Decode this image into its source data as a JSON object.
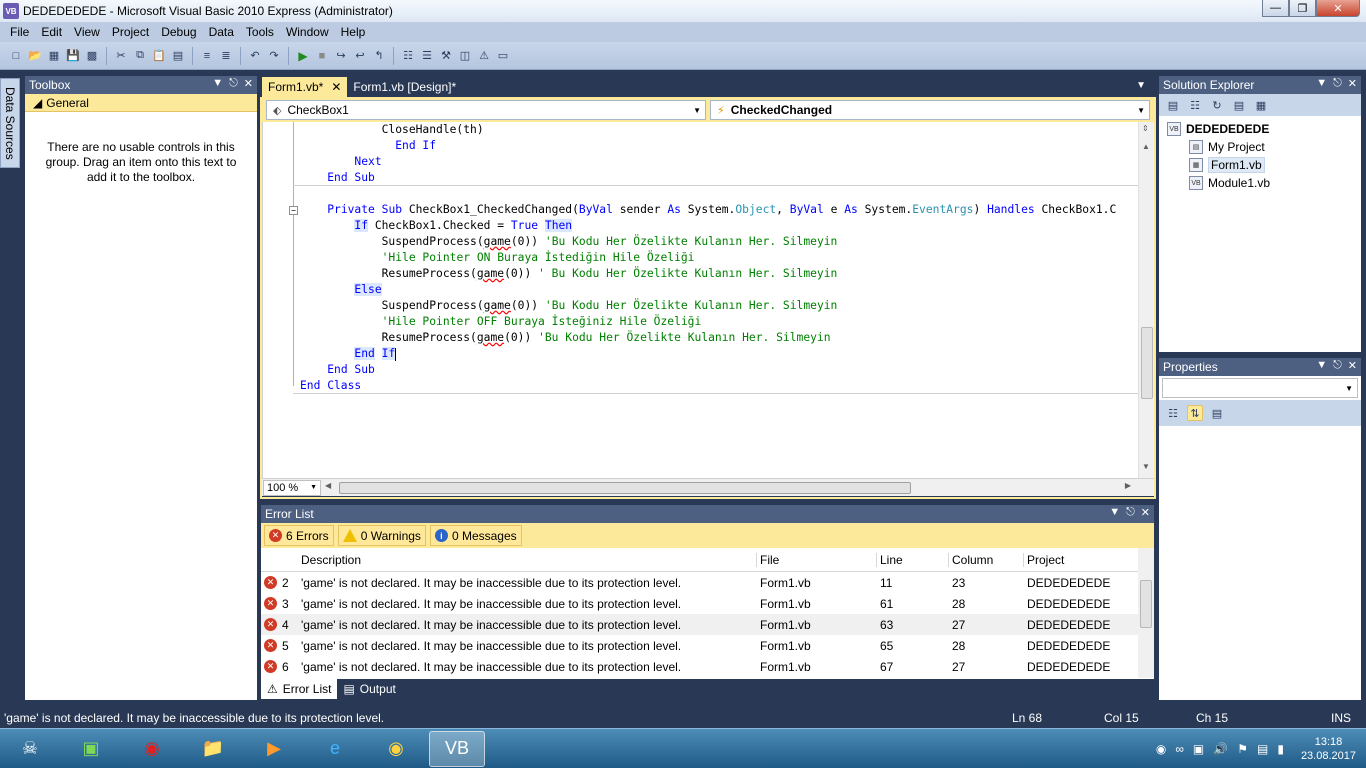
{
  "window": {
    "title": "DEDEDEDEDE - Microsoft Visual Basic 2010 Express (Administrator)",
    "icon": "vb-app-icon"
  },
  "menu": [
    "File",
    "Edit",
    "View",
    "Project",
    "Debug",
    "Data",
    "Tools",
    "Window",
    "Help"
  ],
  "side_tab": "Data Sources",
  "toolbox": {
    "title": "Toolbox",
    "group": "General",
    "message": "There are no usable controls in this group. Drag an item onto this text to add it to the toolbox."
  },
  "editor": {
    "tabs": [
      {
        "label": "Form1.vb*",
        "active": true
      },
      {
        "label": "Form1.vb [Design]*",
        "active": false
      }
    ],
    "object_combo": "CheckBox1",
    "event_combo": "CheckedChanged",
    "code": {
      "l1": "            CloseHandle(th)",
      "l2_kw": "End If",
      "l3_kw": "Next",
      "l4_kw": "End Sub",
      "sub_private": "Private",
      "sub_sub": "Sub",
      "sub_name": " CheckBox1_CheckedChanged(",
      "sub_byval1": "ByVal",
      "sub_sender": " sender ",
      "sub_as1": "As",
      "sub_sys1": " System.",
      "sub_object": "Object",
      "sub_comma": ", ",
      "sub_byval2": "ByVal",
      "sub_e": " e ",
      "sub_as2": "As",
      "sub_sys2": " System.",
      "sub_eventargs": "EventArgs",
      "sub_close": ") ",
      "sub_handles": "Handles",
      "sub_handles_target": " CheckBox1.C",
      "if_kw": "If",
      "if_cond": " CheckBox1.Checked = ",
      "if_true": "True",
      "if_then": "Then",
      "call_suspend": "SuspendProcess(",
      "call_resume": "ResumeProcess(",
      "game": "game",
      "args": "(0)) ",
      "args2": "(0)) ",
      "args_resume1": "(0)) ",
      "c1": "'Bu Kodu Her Özelikte Kulanın Her. Silmeyin",
      "c2": "'Hile Pointer ON Buraya İstediğin Hile Özeliği",
      "c3": "' Bu Kodu Her Özelikte Kulanın Her. Silmeyin",
      "else_kw": "Else",
      "c4": "'Bu Kodu Her Özelikte Kulanın Her. Silmeyin",
      "c5": "'Hile Pointer OFF Buraya İsteğiniz Hile Özeliği",
      "c6": "'Bu Kodu Her Özelikte Kulanın Her. Silmeyin",
      "endif_end": "End",
      "endif_if": "If",
      "endsub_kw": "End Sub",
      "endclass_kw": "End Class"
    },
    "zoom": "100 %"
  },
  "error_list": {
    "title": "Error List",
    "filters": {
      "errors": "6 Errors",
      "warnings": "0 Warnings",
      "messages": "0 Messages"
    },
    "columns": [
      "Description",
      "File",
      "Line",
      "Column",
      "Project"
    ],
    "rows": [
      {
        "num": "2",
        "desc": "'game' is not declared. It may be inaccessible due to its protection level.",
        "file": "Form1.vb",
        "line": "11",
        "column": "23",
        "project": "DEDEDEDEDE"
      },
      {
        "num": "3",
        "desc": "'game' is not declared. It may be inaccessible due to its protection level.",
        "file": "Form1.vb",
        "line": "61",
        "column": "28",
        "project": "DEDEDEDEDE"
      },
      {
        "num": "4",
        "desc": "'game' is not declared. It may be inaccessible due to its protection level.",
        "file": "Form1.vb",
        "line": "63",
        "column": "27",
        "project": "DEDEDEDEDE"
      },
      {
        "num": "5",
        "desc": "'game' is not declared. It may be inaccessible due to its protection level.",
        "file": "Form1.vb",
        "line": "65",
        "column": "28",
        "project": "DEDEDEDEDE"
      },
      {
        "num": "6",
        "desc": "'game' is not declared. It may be inaccessible due to its protection level.",
        "file": "Form1.vb",
        "line": "67",
        "column": "27",
        "project": "DEDEDEDEDE"
      }
    ],
    "bottom_tabs": [
      "Error List",
      "Output"
    ]
  },
  "solution_explorer": {
    "title": "Solution Explorer",
    "root": "DEDEDEDEDE",
    "items": [
      "My Project",
      "Form1.vb",
      "Module1.vb"
    ],
    "selected": "Form1.vb"
  },
  "properties": {
    "title": "Properties"
  },
  "status": {
    "message": "'game' is not declared. It may be inaccessible due to its protection level.",
    "ln": "Ln 68",
    "col": "Col 15",
    "ch": "Ch 15",
    "mode": "INS"
  },
  "taskbar": {
    "clock_time": "13:18",
    "clock_date": "23.08.2017"
  },
  "colors": {
    "accent_yellow": "#fce99a",
    "frame_blue": "#293955",
    "keyword": "#0000ff",
    "type": "#2b91af",
    "comment": "#008000"
  }
}
